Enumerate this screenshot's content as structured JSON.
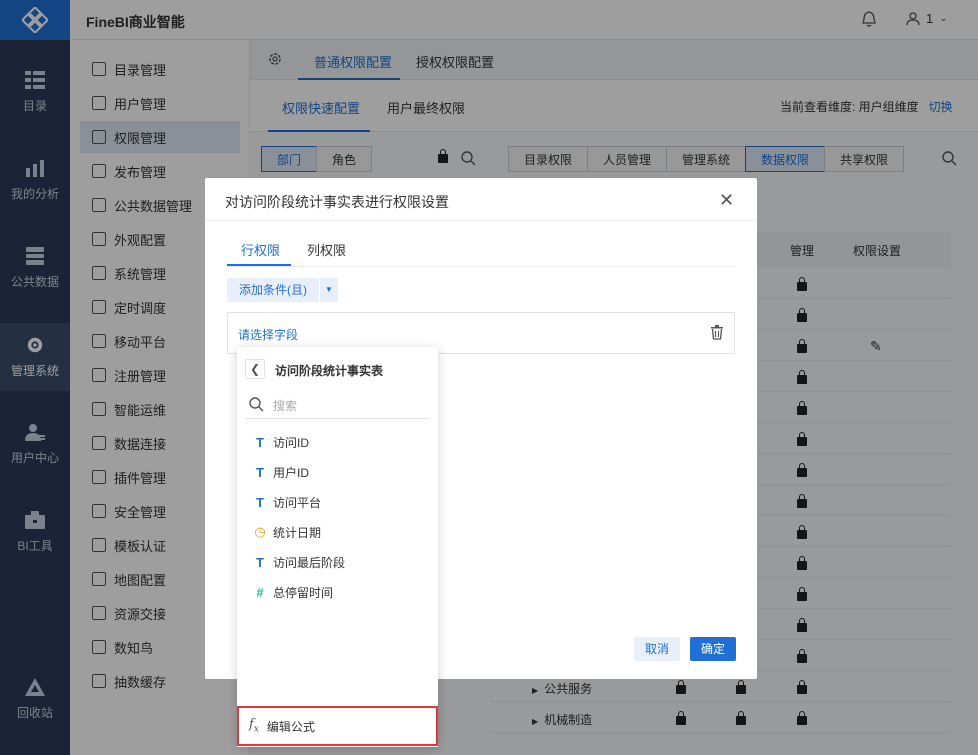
{
  "app": {
    "title": "FineBI商业智能",
    "user_label": "1"
  },
  "rail": {
    "items": [
      {
        "label": "目录",
        "icon": "directory-icon"
      },
      {
        "label": "我的分析",
        "icon": "chart-icon"
      },
      {
        "label": "公共数据",
        "icon": "database-icon"
      },
      {
        "label": "管理系统",
        "icon": "gear-icon"
      },
      {
        "label": "用户中心",
        "icon": "user-icon"
      },
      {
        "label": "BI工具",
        "icon": "toolbox-icon"
      },
      {
        "label": "回收站",
        "icon": "recycle-icon"
      }
    ]
  },
  "sidebar": {
    "items": [
      "目录管理",
      "用户管理",
      "权限管理",
      "发布管理",
      "公共数据管理",
      "外观配置",
      "系统管理",
      "定时调度",
      "移动平台",
      "注册管理",
      "智能运维",
      "数据连接",
      "插件管理",
      "安全管理",
      "模板认证",
      "地图配置",
      "资源交接",
      "数知鸟",
      "抽数缓存"
    ]
  },
  "main": {
    "tabs": [
      "普通权限配置",
      "授权权限配置"
    ],
    "subtabs": [
      "权限快速配置",
      "用户最终权限"
    ],
    "dimension": {
      "label": "当前查看维度: 用户组维度",
      "switch": "切换"
    },
    "role_tabs": [
      "部门",
      "角色"
    ],
    "perm_tabs": [
      "目录权限",
      "人员管理",
      "管理系统",
      "数据权限",
      "共享权限"
    ],
    "table_headers": [
      "管理",
      "权限设置"
    ],
    "tree_rows": [
      "公共服务",
      "机械制造"
    ]
  },
  "modal": {
    "title": "对访问阶段统计事实表进行权限设置",
    "tabs": [
      "行权限",
      "列权限"
    ],
    "add_condition": "添加条件(且)",
    "field_placeholder": "请选择字段",
    "cancel": "取消",
    "ok": "确定"
  },
  "panel": {
    "title": "访问阶段统计事实表",
    "search_placeholder": "搜索",
    "fields": [
      {
        "label": "访问ID",
        "type": "text",
        "icon": "T",
        "color": "#1f6fd6"
      },
      {
        "label": "用户ID",
        "type": "text",
        "icon": "T",
        "color": "#1f6fd6"
      },
      {
        "label": "访问平台",
        "type": "text",
        "icon": "T",
        "color": "#1f6fd6"
      },
      {
        "label": "统计日期",
        "type": "date",
        "icon": "◷",
        "color": "#e6a01a"
      },
      {
        "label": "访问最后阶段",
        "type": "text",
        "icon": "T",
        "color": "#1f6fd6"
      },
      {
        "label": "总停留时间",
        "type": "number",
        "icon": "#",
        "color": "#2fb89a"
      }
    ],
    "formula": "编辑公式"
  }
}
